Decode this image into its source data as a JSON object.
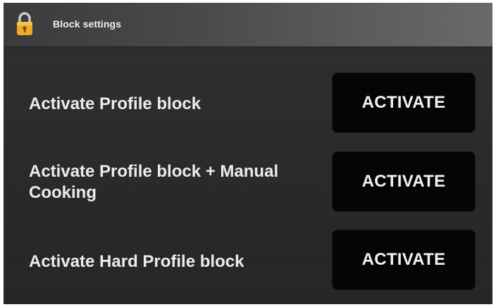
{
  "header": {
    "title": "Block settings",
    "icon": "lock-icon"
  },
  "rows": [
    {
      "label": "Activate Profile block",
      "button_label": "ACTIVATE"
    },
    {
      "label": "Activate Profile block + Manual Cooking",
      "button_label": "ACTIVATE"
    },
    {
      "label": "Activate Hard Profile block",
      "button_label": "ACTIVATE"
    }
  ],
  "colors": {
    "lock_icon": "#f0a928",
    "button_bg": "#050505",
    "text": "#ececec"
  }
}
